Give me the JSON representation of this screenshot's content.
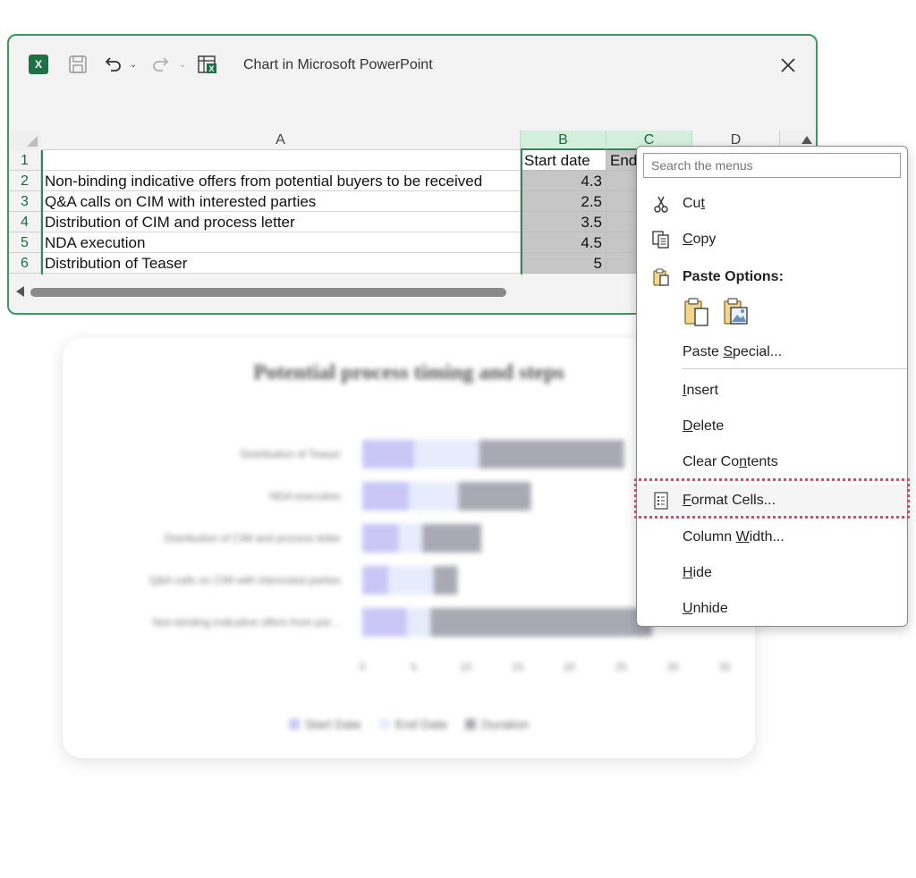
{
  "window": {
    "title": "Chart in Microsoft PowerPoint",
    "excel_icon_letter": "X",
    "close_glyph": "✕"
  },
  "grid": {
    "columns": [
      {
        "label": "A"
      },
      {
        "label": "B"
      },
      {
        "label": "C"
      },
      {
        "label": "D"
      }
    ],
    "rows": [
      {
        "num": "1",
        "a": "",
        "b": "Start date",
        "c": "End"
      },
      {
        "num": "2",
        "a": "Non-binding indicative offers from potential buyers to be received",
        "b": "4.3",
        "c": ""
      },
      {
        "num": "3",
        "a": "Q&A calls on CIM with interested parties",
        "b": "2.5",
        "c": ""
      },
      {
        "num": "4",
        "a": "Distribution of CIM and process letter",
        "b": "3.5",
        "c": ""
      },
      {
        "num": "5",
        "a": "NDA execution",
        "b": "4.5",
        "c": ""
      },
      {
        "num": "6",
        "a": "Distribution of Teaser",
        "b": "5",
        "c": ""
      }
    ]
  },
  "chart": {
    "title": "Potential process timing and steps",
    "legend": [
      "Start Date",
      "End Date",
      "Duration"
    ],
    "colors": {
      "start": "#c9c6f5",
      "end": "#e6ecfb",
      "duration": "#a9a9b4"
    }
  },
  "chart_data": {
    "type": "bar",
    "orientation": "horizontal",
    "stacked": true,
    "title": "Potential process timing and steps",
    "categories": [
      "Distribution of Teaser",
      "NDA execution",
      "Distribution of CIM and process letter",
      "Q&A calls on CIM with interested parties",
      "Non-binding indicative offers from potential buyers to be received"
    ],
    "series": [
      {
        "name": "Start Date",
        "values": [
          5,
          4.5,
          3.5,
          2.5,
          4.3
        ]
      },
      {
        "name": "End Date",
        "values": [
          6.3,
          4.8,
          2.3,
          4.4,
          2.3
        ]
      },
      {
        "name": "Duration",
        "values": [
          14,
          7,
          5.7,
          2.3,
          21.4
        ]
      }
    ],
    "x_ticks": [
      "0",
      "5",
      "10",
      "15",
      "20",
      "25",
      "30",
      "35"
    ],
    "xlim": [
      0,
      35
    ],
    "legend_position": "bottom"
  },
  "context_menu": {
    "search_placeholder": "Search the menus",
    "items": {
      "cut": {
        "pre": "Cu",
        "u": "t",
        "post": ""
      },
      "copy": {
        "pre": "",
        "u": "C",
        "post": "opy"
      },
      "paste_options": "Paste Options:",
      "paste_special": {
        "pre": "Paste ",
        "u": "S",
        "post": "pecial..."
      },
      "insert": {
        "pre": "",
        "u": "I",
        "post": "nsert"
      },
      "delete": {
        "pre": "",
        "u": "D",
        "post": "elete"
      },
      "clear_contents": {
        "pre": "Clear Co",
        "u": "n",
        "post": "tents"
      },
      "format_cells": {
        "pre": "",
        "u": "F",
        "post": "ormat Cells..."
      },
      "column_width": {
        "pre": "Column ",
        "u": "W",
        "post": "idth..."
      },
      "hide": {
        "pre": "",
        "u": "H",
        "post": "ide"
      },
      "unhide": {
        "pre": "",
        "u": "U",
        "post": "nhide"
      }
    }
  }
}
